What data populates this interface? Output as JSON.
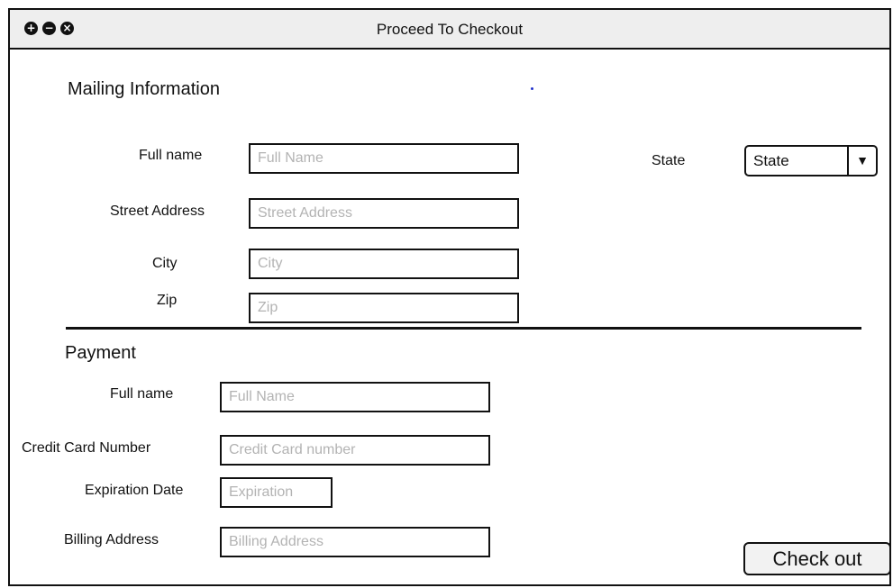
{
  "window": {
    "title": "Proceed To Checkout",
    "controls": {
      "add": "+",
      "minimize": "−",
      "close": "×"
    }
  },
  "mailing": {
    "heading": "Mailing Information",
    "full_name": {
      "label": "Full name",
      "placeholder": "Full Name",
      "value": ""
    },
    "street": {
      "label": "Street Address",
      "placeholder": "Street Address",
      "value": ""
    },
    "city": {
      "label": "City",
      "placeholder": "City",
      "value": ""
    },
    "zip": {
      "label": "Zip",
      "placeholder": "Zip",
      "value": ""
    },
    "state": {
      "label": "State",
      "selected": "State",
      "arrow": "▼"
    }
  },
  "payment": {
    "heading": "Payment",
    "full_name": {
      "label": "Full name",
      "placeholder": "Full Name",
      "value": ""
    },
    "card": {
      "label": "Credit Card Number",
      "placeholder": "Credit Card number",
      "value": ""
    },
    "expiration": {
      "label": "Expiration Date",
      "placeholder": "Expiration",
      "value": ""
    },
    "billing": {
      "label": "Billing Address",
      "placeholder": "Billing Address",
      "value": ""
    }
  },
  "actions": {
    "checkout_label": "Check out"
  },
  "colors": {
    "title_bar": "#eeeeee",
    "placeholder": "#b3b3b3",
    "stray_dot": "#2233cc"
  }
}
